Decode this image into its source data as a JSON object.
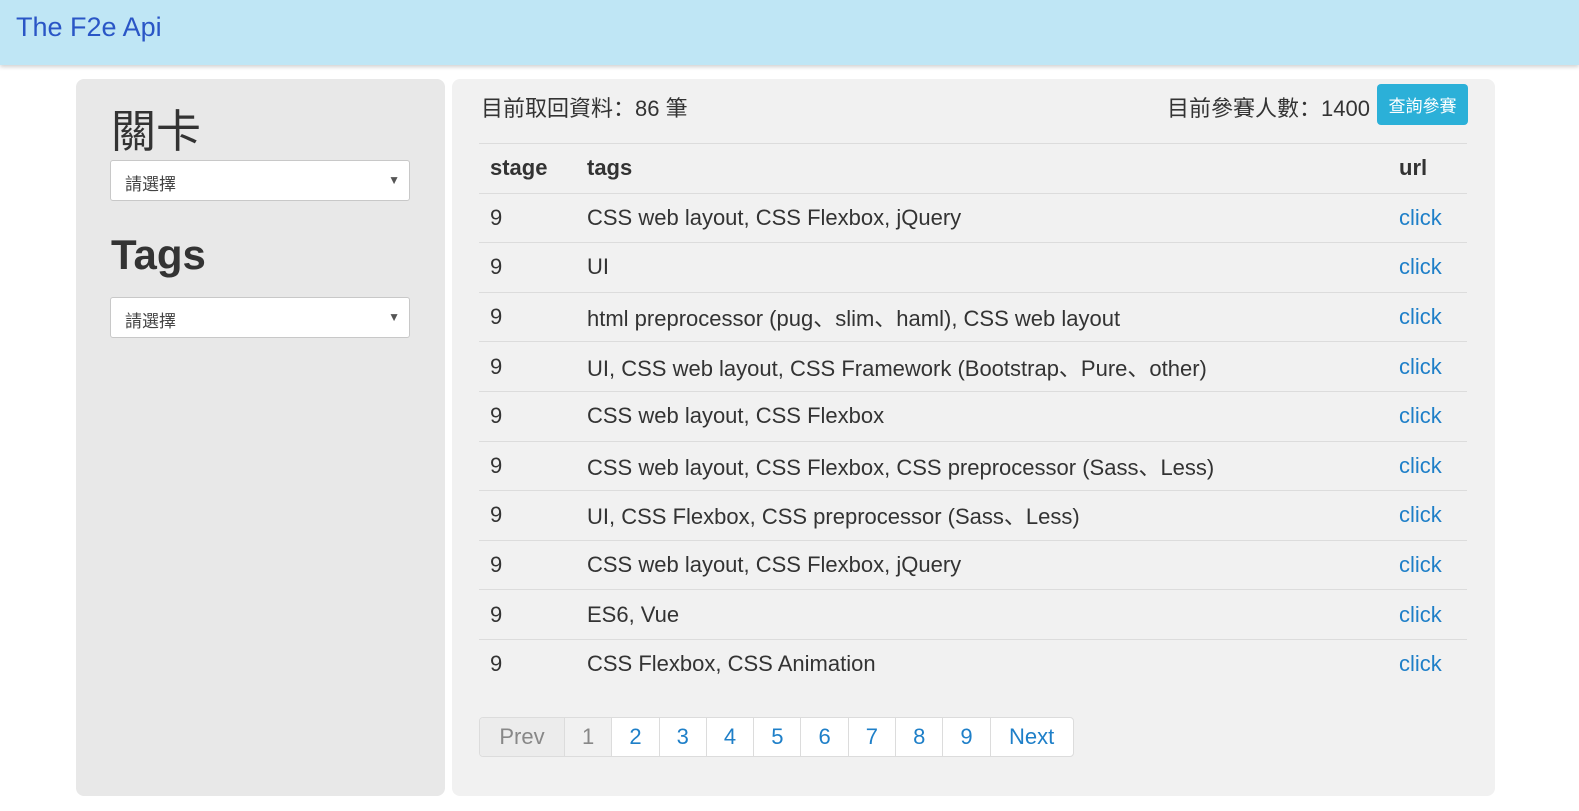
{
  "navbar": {
    "brand": "The F2e Api"
  },
  "sidebar": {
    "stage_title": "關卡",
    "stage_select": {
      "value": "請選擇"
    },
    "tags_title": "Tags",
    "tags_select": {
      "value": "請選擇"
    }
  },
  "main": {
    "count_text": "目前取回資料：86 筆",
    "participants_text": "目前參賽人數：1400",
    "query_button": "查詢參賽",
    "table": {
      "headers": {
        "stage": "stage",
        "tags": "tags",
        "url": "url"
      },
      "rows": [
        {
          "stage": "9",
          "tags": "CSS web layout, CSS Flexbox, jQuery",
          "url": "click"
        },
        {
          "stage": "9",
          "tags": "UI",
          "url": "click"
        },
        {
          "stage": "9",
          "tags": "html preprocessor (pug、slim、haml), CSS web layout",
          "url": "click"
        },
        {
          "stage": "9",
          "tags": "UI, CSS web layout, CSS Framework (Bootstrap、Pure、other)",
          "url": "click"
        },
        {
          "stage": "9",
          "tags": "CSS web layout, CSS Flexbox",
          "url": "click"
        },
        {
          "stage": "9",
          "tags": "CSS web layout, CSS Flexbox, CSS preprocessor (Sass、Less)",
          "url": "click"
        },
        {
          "stage": "9",
          "tags": "UI, CSS Flexbox, CSS preprocessor (Sass、Less)",
          "url": "click"
        },
        {
          "stage": "9",
          "tags": "CSS web layout, CSS Flexbox, jQuery",
          "url": "click"
        },
        {
          "stage": "9",
          "tags": "ES6, Vue",
          "url": "click"
        },
        {
          "stage": "9",
          "tags": "CSS Flexbox, CSS Animation",
          "url": "click"
        }
      ]
    },
    "pagination": {
      "prev": "Prev",
      "pages": [
        "1",
        "2",
        "3",
        "4",
        "5",
        "6",
        "7",
        "8",
        "9"
      ],
      "active_page": "1",
      "next": "Next"
    }
  },
  "colors": {
    "navbar_bg": "#bfe6f5",
    "brand": "#2a56c6",
    "link": "#1e7fc8",
    "button": "#2bb0d8"
  }
}
